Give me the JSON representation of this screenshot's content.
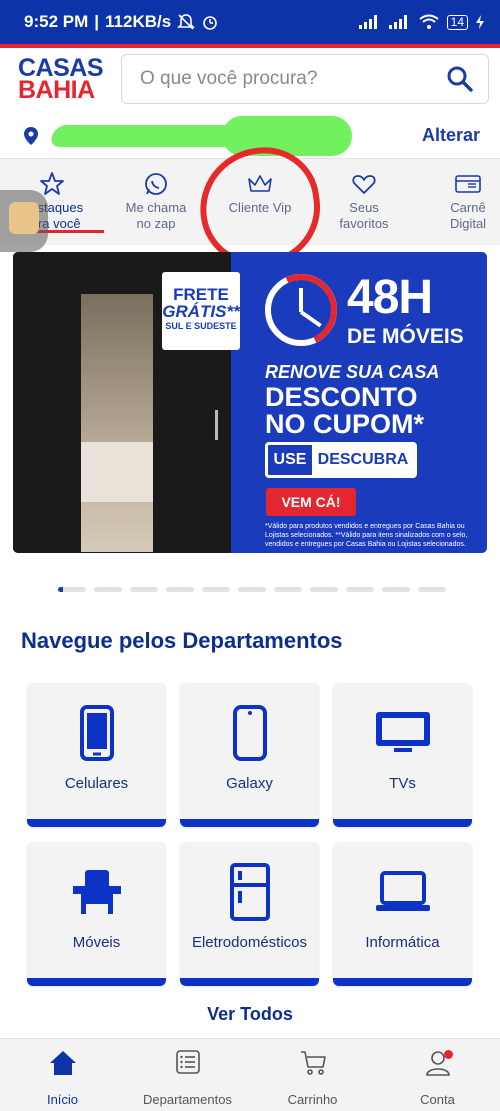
{
  "status_bar": {
    "time": "9:52 PM",
    "separator": "|",
    "speed": "112KB/s",
    "battery": "14"
  },
  "header": {
    "logo_line1": "CASAS",
    "logo_line2": "BAHIA",
    "search_placeholder": "O que você procura?"
  },
  "location": {
    "change_label": "Alterar"
  },
  "shortcuts": [
    {
      "label_line1": "Destaques",
      "label_line2": "para você",
      "icon": "star-icon",
      "active": true
    },
    {
      "label_line1": "Me chama",
      "label_line2": "no zap",
      "icon": "whatsapp-icon"
    },
    {
      "label_line1": "Cliente Vip",
      "label_line2": "",
      "icon": "crown-icon"
    },
    {
      "label_line1": "Seus",
      "label_line2": "favoritos",
      "icon": "heart-icon"
    },
    {
      "label_line1": "Carnê",
      "label_line2": "Digital",
      "icon": "card-icon"
    }
  ],
  "banner": {
    "frete_1": "FRETE",
    "frete_2": "GRÁTIS**",
    "frete_3": "SUL E SUDESTE",
    "headline": "48H",
    "subheadline": "DE MÓVEIS",
    "renove": "RENOVE SUA CASA",
    "desconto_1": "DESCONTO",
    "desconto_2": "NO CUPOM*",
    "use_label": "USE",
    "coupon": "DESCUBRA",
    "cta": "VEM CÁ!",
    "fine_print": "*Válido para produtos vendidos e entregues por Casas Bahia ou Lojistas selecionados. **Válido para itens sinalizados com o selo, vendidos e entregues por Casas Bahia ou Lojistas selecionados."
  },
  "carousel": {
    "count": 11,
    "active": 0
  },
  "departments": {
    "title": "Navegue pelos Departamentos",
    "items": [
      {
        "label": "Celulares",
        "icon": "smartphone-icon"
      },
      {
        "label": "Galaxy",
        "icon": "galaxy-phone-icon"
      },
      {
        "label": "TVs",
        "icon": "tv-icon"
      },
      {
        "label": "Móveis",
        "icon": "armchair-icon"
      },
      {
        "label": "Eletrodomésticos",
        "icon": "refrigerator-icon"
      },
      {
        "label": "Informática",
        "icon": "laptop-icon"
      }
    ],
    "see_all": "Ver Todos"
  },
  "bottom_nav": [
    {
      "label": "Início",
      "icon": "home-icon",
      "active": true
    },
    {
      "label": "Departamentos",
      "icon": "list-icon"
    },
    {
      "label": "Carrinho",
      "icon": "cart-icon"
    },
    {
      "label": "Conta",
      "icon": "account-icon"
    }
  ],
  "colors": {
    "brand_blue": "#0d33a8",
    "brand_red": "#e3262f",
    "scribble_red": "#e62a2a",
    "redaction_green": "#73f060"
  }
}
